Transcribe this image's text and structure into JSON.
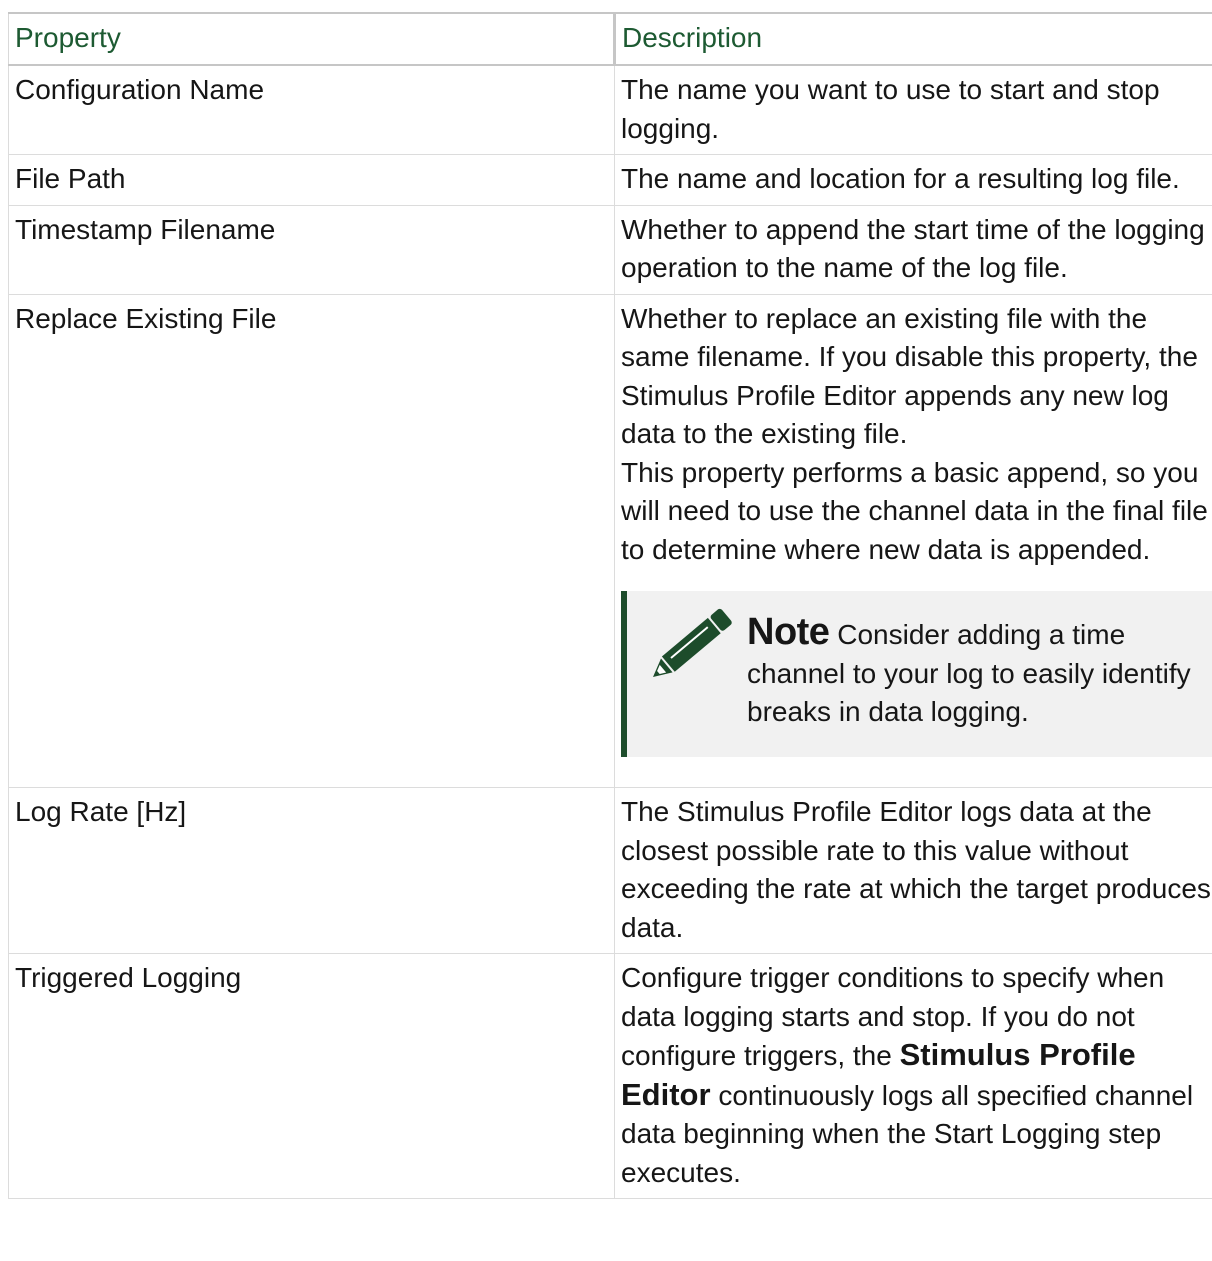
{
  "table": {
    "headers": {
      "property": "Property",
      "description": "Description"
    },
    "rows": [
      {
        "property": "Configuration Name",
        "description": "The name you want to use to start and stop logging."
      },
      {
        "property": "File Path",
        "description": "The name and location for a resulting log file."
      },
      {
        "property": "Timestamp Filename",
        "description": "Whether to append the start time of the logging operation to the name of the log file."
      },
      {
        "property": "Replace Existing File",
        "description": "Whether to replace an existing file with the same filename. If you disable this property, the Stimulus Profile Editor appends any new log data to the existing file.",
        "description_2": "This property performs a basic append, so you will need to use the channel data in the final file to determine where new data is appended.",
        "note": {
          "icon": "pencil-icon",
          "label": "Note",
          "text": "Consider adding a time channel to your log to easily identify breaks in data logging."
        }
      },
      {
        "property": "Log Rate [Hz]",
        "description": "The Stimulus Profile Editor logs data at the closest possible rate to this value without exceeding the rate at which the target produces data."
      },
      {
        "property": "Triggered Logging",
        "description_before": "Configure trigger conditions to specify when data logging starts and stop. If you do not configure triggers, the",
        "description_bold": "Stimulus Profile Editor",
        "description_after": "continuously logs all specified channel data beginning when the Start Logging step executes."
      }
    ]
  },
  "colors": {
    "header_text": "#1d5a32",
    "note_bar": "#1d4c2b",
    "note_background": "#f1f1f1",
    "pencil_icon": "#1d4c2b"
  }
}
